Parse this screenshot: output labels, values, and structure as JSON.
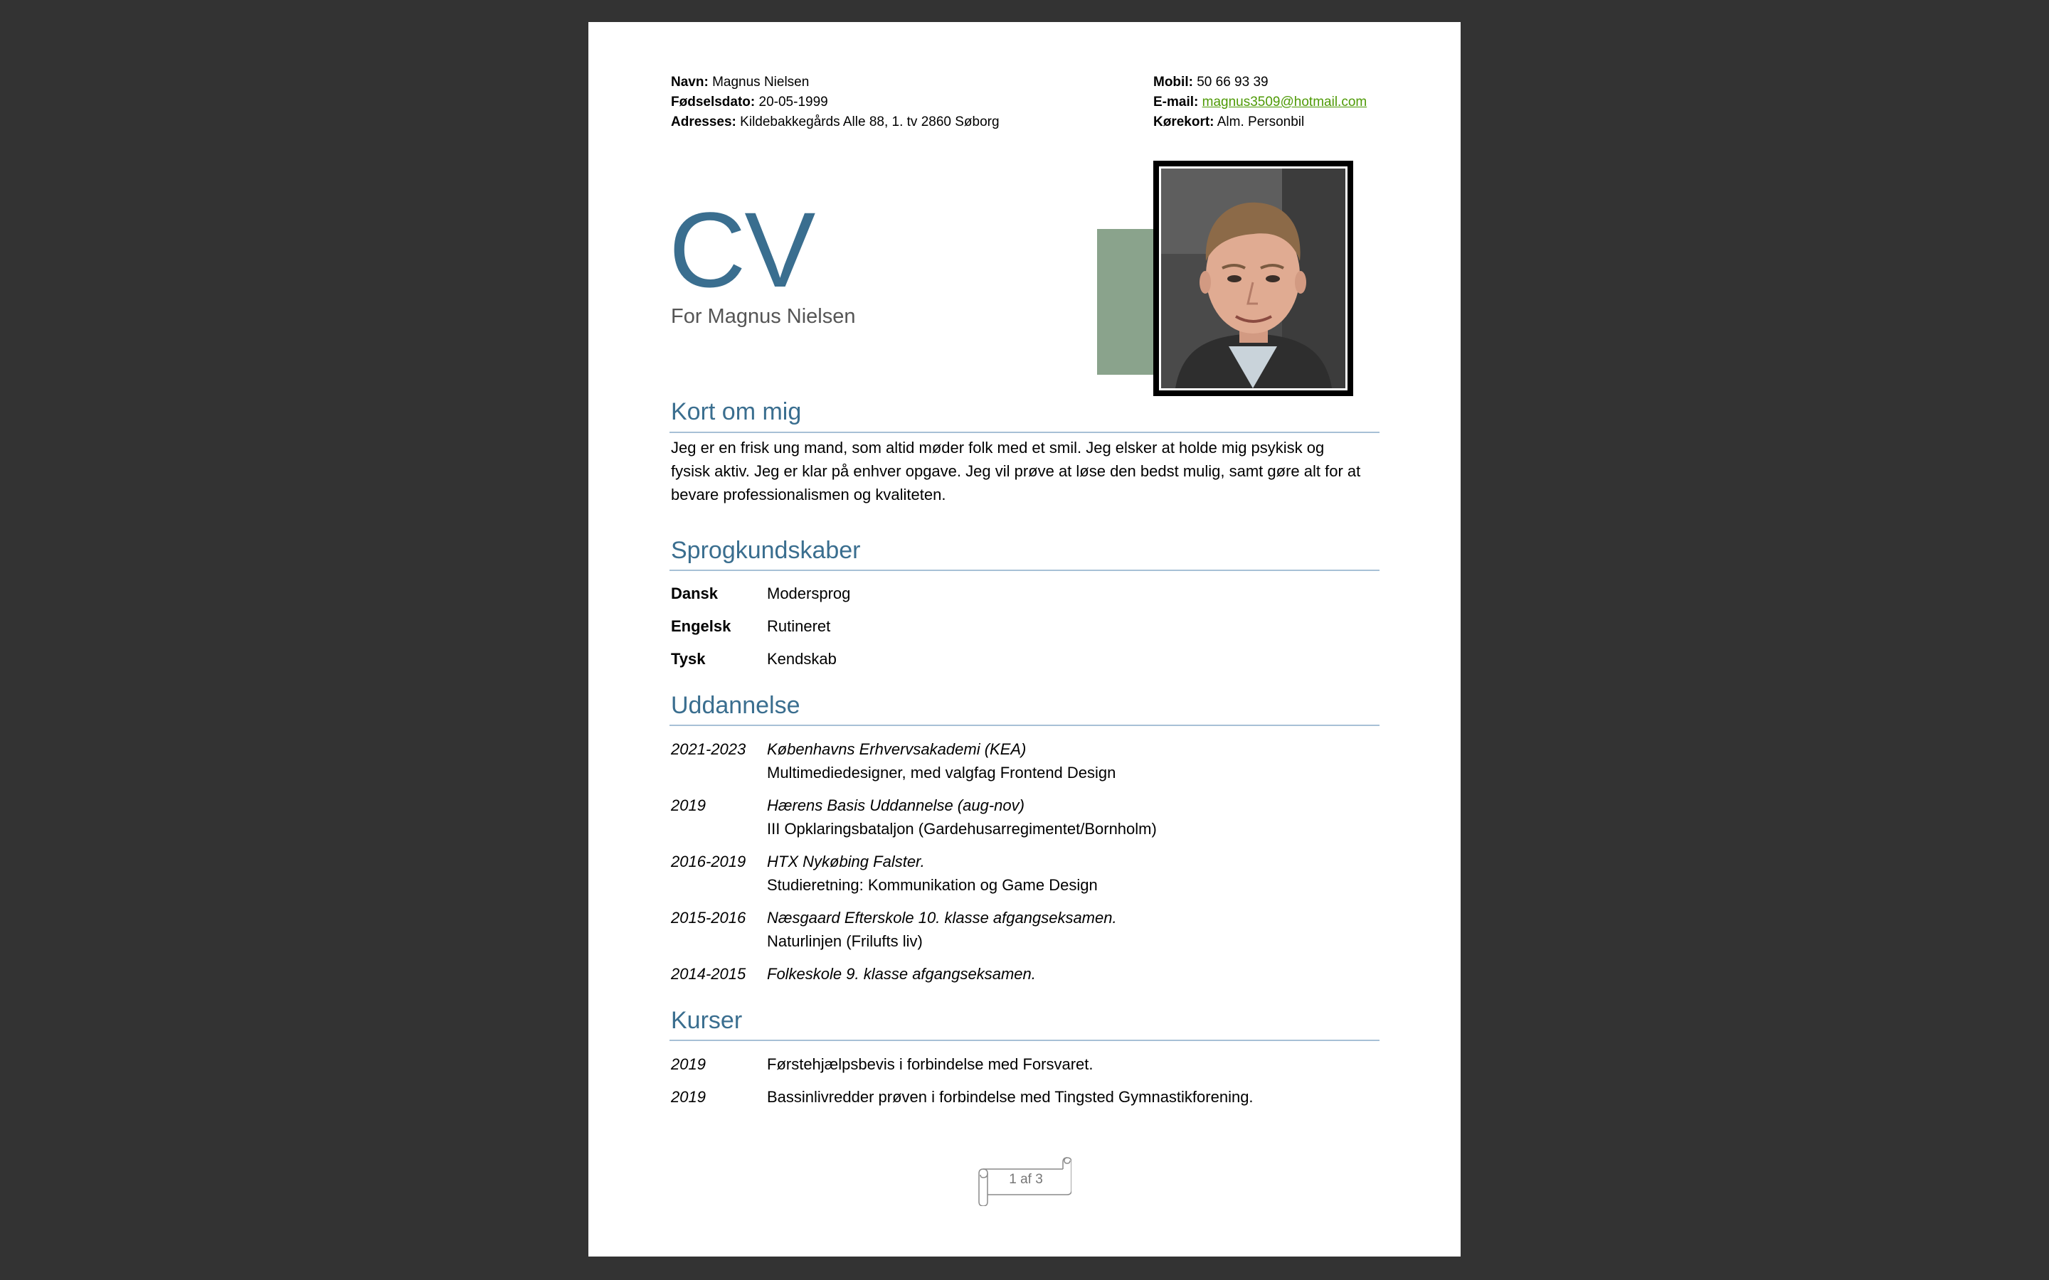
{
  "header": {
    "left": [
      {
        "label": "Navn:",
        "value": "Magnus Nielsen"
      },
      {
        "label": "Fødselsdato:",
        "value": "20-05-1999"
      },
      {
        "label": "Adresses:",
        "value": "Kildebakkegårds Alle 88, 1. tv 2860 Søborg"
      }
    ],
    "right": [
      {
        "label": "Mobil:",
        "value": "50 66 93 39"
      },
      {
        "label": "E-mail:",
        "value": "magnus3509@hotmail.com"
      },
      {
        "label": "Kørekort:",
        "value": "Alm. Personbil"
      }
    ]
  },
  "title": "CV",
  "subtitle": "For Magnus Nielsen",
  "sections": {
    "about": {
      "title": "Kort om mig",
      "lines": [
        "Jeg er en frisk ung mand, som altid møder folk med et smil. Jeg elsker at holde mig psykisk og",
        "fysisk aktiv. Jeg er klar på enhver opgave. Jeg vil prøve at løse den bedst mulig, samt gøre alt for at",
        "bevare professionalismen og kvaliteten."
      ]
    },
    "languages": {
      "title": "Sprogkundskaber",
      "items": [
        {
          "language": "Dansk",
          "level": "Modersprog"
        },
        {
          "language": "Engelsk",
          "level": "Rutineret"
        },
        {
          "language": "Tysk",
          "level": "Kendskab"
        }
      ]
    },
    "education": {
      "title": "Uddannelse",
      "items": [
        {
          "period": "2021-2023",
          "school": "Københavns Erhvervsakademi (KEA)",
          "detail": "Multimediedesigner, med valgfag Frontend Design"
        },
        {
          "period": "2019",
          "school": "Hærens Basis Uddannelse (aug-nov)",
          "detail": "III Opklaringsbataljon (Gardehusarregimentet/Bornholm)"
        },
        {
          "period": "2016-2019",
          "school": "HTX Nykøbing Falster.",
          "detail": "Studieretning: Kommunikation og Game Design"
        },
        {
          "period": "2015-2016",
          "school": "Næsgaard Efterskole 10. klasse afgangseksamen.",
          "detail": "Naturlinjen (Frilufts liv)"
        },
        {
          "period": "2014-2015",
          "school": "Folkeskole 9. klasse afgangseksamen.",
          "detail": ""
        }
      ]
    },
    "courses": {
      "title": "Kurser",
      "items": [
        {
          "year": "2019",
          "text": "Førstehjælpsbevis i forbindelse med Forsvaret."
        },
        {
          "year": "2019",
          "text": "Bassinlivredder prøven i forbindelse med Tingsted Gymnastikforening."
        }
      ]
    }
  },
  "footer": {
    "page_label": "1 af 3"
  },
  "colors": {
    "background": "#333333",
    "page": "#ffffff",
    "accent": "#3a6e8f",
    "green_block": "#8aa38c",
    "link": "#4e9a06"
  }
}
